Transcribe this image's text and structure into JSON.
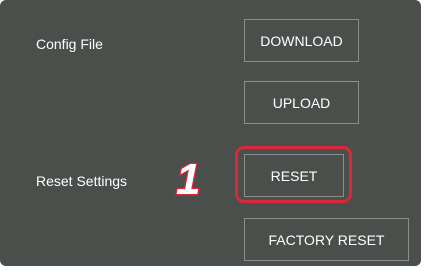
{
  "config_file": {
    "label": "Config File",
    "download_label": "DOWNLOAD",
    "upload_label": "UPLOAD"
  },
  "reset_settings": {
    "label": "Reset Settings",
    "reset_label": "RESET",
    "factory_reset_label": "FACTORY RESET"
  },
  "annotation": {
    "step_number": "1",
    "highlight_color": "#d8283a"
  },
  "colors": {
    "panel_background": "#4b4f4c",
    "button_border": "#8a8f8c",
    "text": "#ffffff"
  }
}
